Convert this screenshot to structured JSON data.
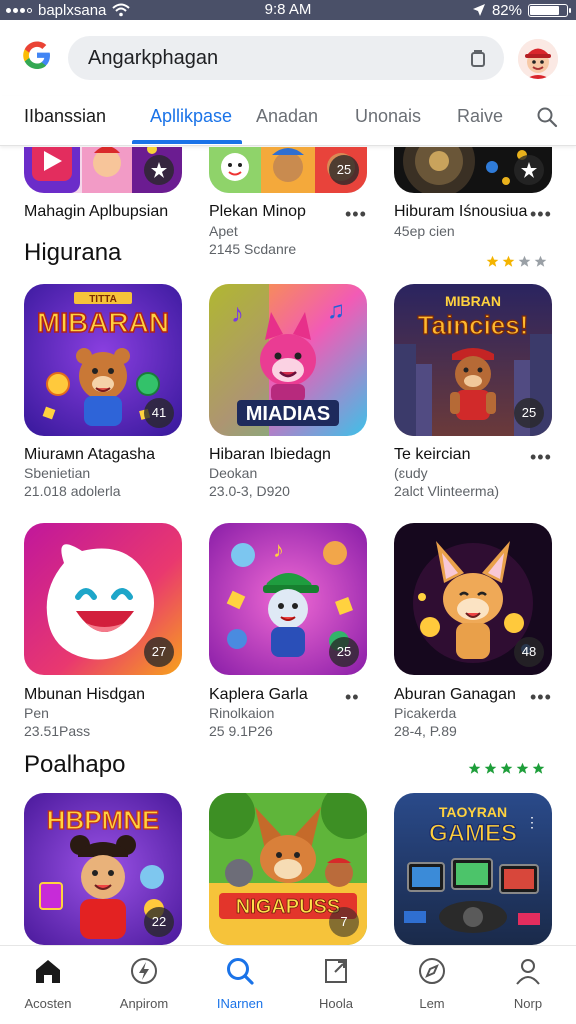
{
  "status": {
    "carrier": "baplxsana",
    "time": "9:8 AM",
    "battery": "82%",
    "battery_level": 0.82
  },
  "search": {
    "query": "Angarkphagan"
  },
  "tabs": [
    {
      "label": "IIbanssian"
    },
    {
      "label": "Apllikpase"
    },
    {
      "label": "Anadan"
    },
    {
      "label": "Unonais"
    },
    {
      "label": "Raive"
    }
  ],
  "top_row": [
    {
      "name": "Mahagin Aplbupsian",
      "badge": "",
      "sub1": "",
      "sub2": ""
    },
    {
      "name": "Plekan Minop",
      "badge": "25",
      "sub1": "Apet",
      "sub2": "2145 Scdanre"
    },
    {
      "name": "Hiburam Iśnousiua",
      "badge": "",
      "sub1": "45ep cien",
      "sub2": ""
    }
  ],
  "section1": {
    "title": "Higurana",
    "rating": 2
  },
  "row1": [
    {
      "name": "Miurамn Atagasha",
      "sub1": "Sbenietian",
      "sub2": "21.018 adolerla",
      "badge": "41",
      "art": "MIBARAN",
      "banner": "TITTA"
    },
    {
      "name": "Hibaran Ibiedagn",
      "sub1": "Deokan",
      "sub2": "23.0-3, D920",
      "badge": "",
      "art": "MIADIAS",
      "banner": ""
    },
    {
      "name": "Te keircian",
      "sub1": "(ɛudy",
      "sub2": "2alct Vlinteerma)",
      "badge": "25",
      "art": "Taincies!",
      "banner": "MIBRAN"
    }
  ],
  "row2": [
    {
      "name": "Mbunan Hisdgan",
      "sub1": "Pen",
      "sub2": "23.51Pass",
      "badge": "27"
    },
    {
      "name": "Kaplera Garla",
      "sub1": "Rinolkaion",
      "sub2": "25 9.1P26",
      "badge": "25"
    },
    {
      "name": "Aburan Ganagan",
      "sub1": "Picakerda",
      "sub2": "28-4, P.89",
      "badge": "48"
    }
  ],
  "section2": {
    "title": "Poalhapo",
    "rating": 5
  },
  "row3": [
    {
      "badge": "22",
      "art": "HBPMNE"
    },
    {
      "badge": "7",
      "art": "NIGAPUSS"
    },
    {
      "badge": "",
      "art": "GAMES",
      "banner": "TAOYRAN"
    }
  ],
  "nav": [
    {
      "label": "Acosten",
      "icon": "home-icon"
    },
    {
      "label": "Anpirom",
      "icon": "lightning-icon"
    },
    {
      "label": "INarnen",
      "icon": "search-icon"
    },
    {
      "label": "Hoola",
      "icon": "bookmark-icon"
    },
    {
      "label": "Lem",
      "icon": "compass-icon"
    },
    {
      "label": "Norp",
      "icon": "person-icon"
    }
  ],
  "colors": {
    "accent": "#1a73e8",
    "star_gold": "#f4b400",
    "star_green": "#1e9e3a",
    "status_bar": "#4a5068"
  }
}
